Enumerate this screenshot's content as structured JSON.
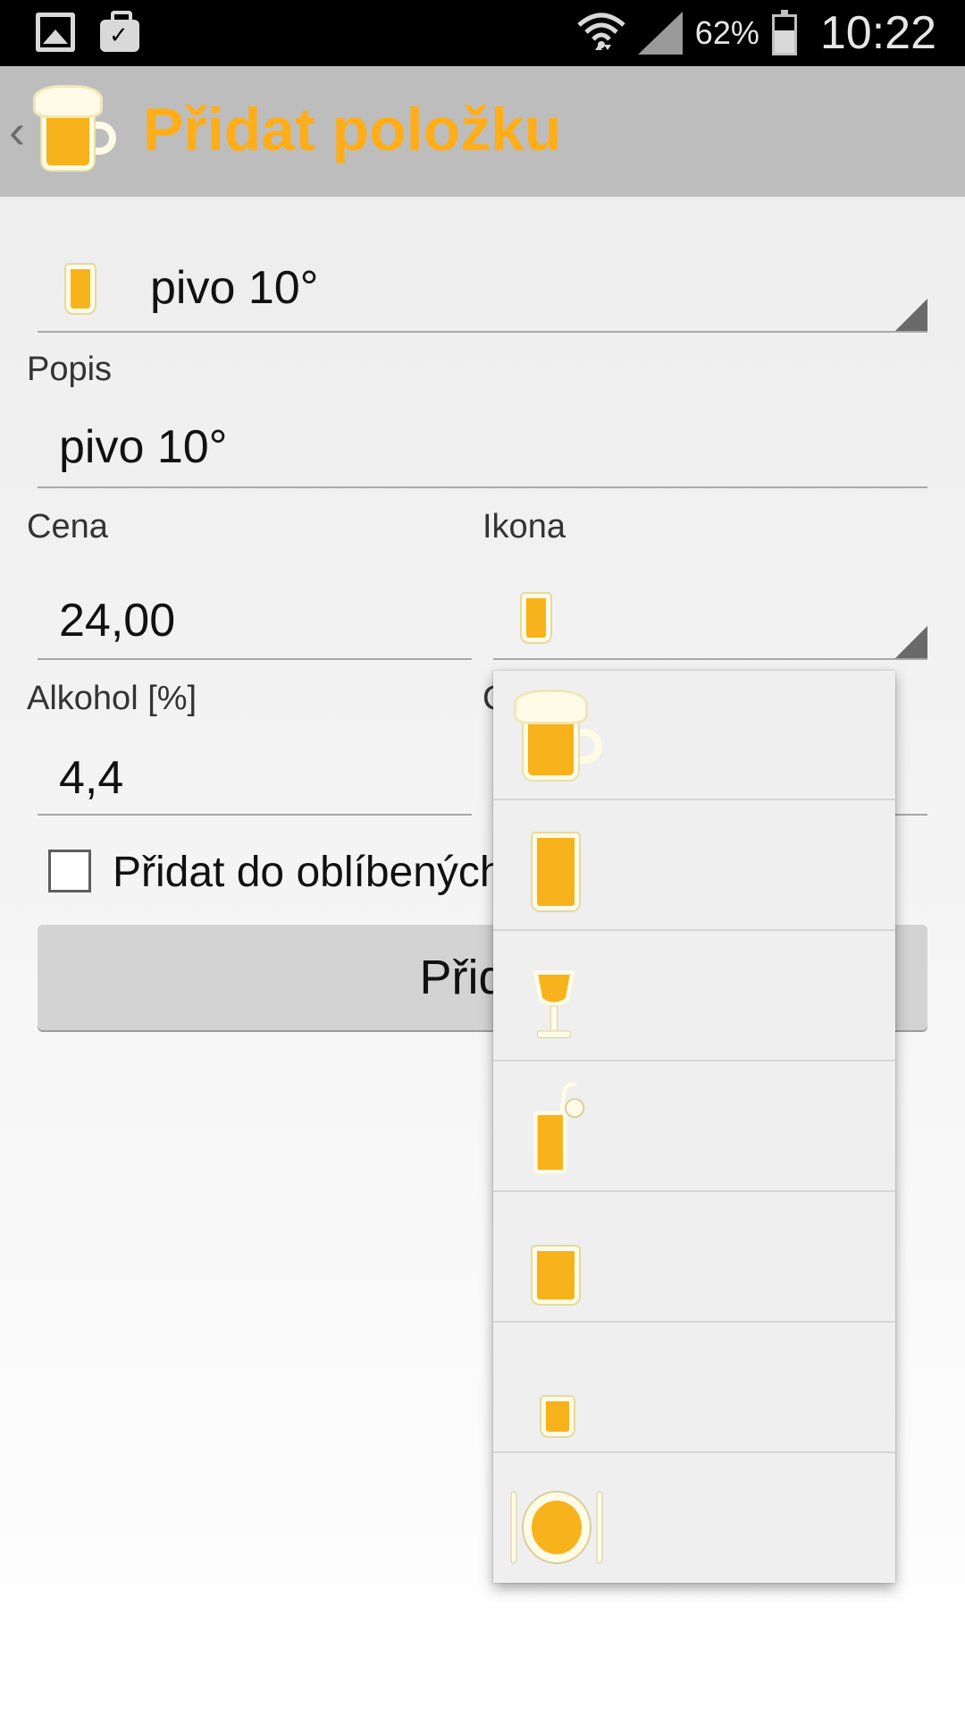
{
  "status_bar": {
    "battery_percent": "62%",
    "time": "10:22",
    "icons": [
      "image-icon",
      "briefcase-check-icon",
      "wifi-icon",
      "signal-icon",
      "battery-icon"
    ]
  },
  "action_bar": {
    "title": "Přidat položku",
    "icon": "beer-mug-icon"
  },
  "form": {
    "item_spinner_value": "pivo 10°",
    "item_spinner_icon": "tall-glass-icon",
    "description_label": "Popis",
    "description_value": "pivo 10°",
    "price_label": "Cena",
    "price_value": "24,00",
    "icon_label": "Ikona",
    "icon_value": "tall-glass-icon",
    "alcohol_label": "Alkohol [%]",
    "alcohol_value": "4,4",
    "hidden_label_partial": "C",
    "favorite_label": "Přidat do oblíbených",
    "favorite_checked": false,
    "add_button_label": "Přidat"
  },
  "icon_dropdown": {
    "options": [
      "beer-mug-icon",
      "tall-glass-icon",
      "wine-glass-icon",
      "cocktail-glass-icon",
      "short-glass-icon",
      "shot-glass-icon",
      "plate-cutlery-icon"
    ]
  },
  "colors": {
    "accent": "#ffae1a",
    "beer": "#f7b21c",
    "foam": "#fffbe6",
    "action_bar": "#bdbdbd"
  }
}
